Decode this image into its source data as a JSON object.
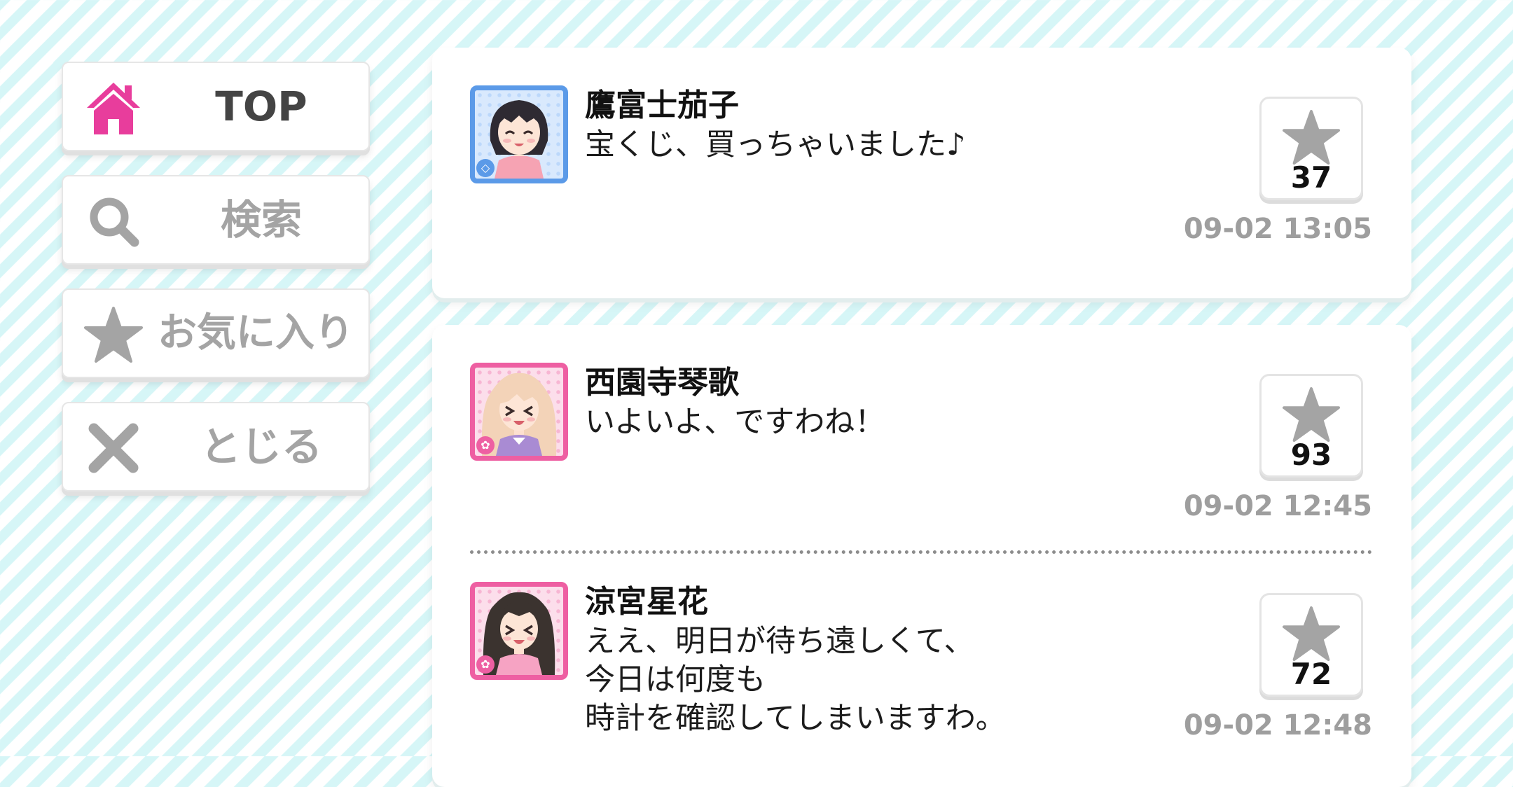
{
  "menu": {
    "items": [
      {
        "label": "TOP",
        "icon": "home-icon",
        "active": true
      },
      {
        "label": "検索",
        "icon": "search-icon",
        "active": false
      },
      {
        "label": "お気に入り",
        "icon": "star-icon",
        "active": false
      },
      {
        "label": "とじる",
        "icon": "close-icon",
        "active": false
      }
    ]
  },
  "colors": {
    "accent_pink": "#e83d9c",
    "icon_gray": "#a4a4a4",
    "stripe": "#d6f6f7",
    "avatar_blue": "#5b9ae8",
    "avatar_pink": "#ee5fa2"
  },
  "posts": [
    {
      "name": "鷹富士茄子",
      "message_lines": [
        "宝くじ、買っちゃいました♪"
      ],
      "likes": "37",
      "time": "09-02 13:05",
      "avatar_frame": "blue",
      "avatar_badge_icon": "diamond-icon"
    },
    {
      "name": "西園寺琴歌",
      "message_lines": [
        "いよいよ、ですわね！"
      ],
      "likes": "93",
      "time": "09-02 12:45",
      "avatar_frame": "pink",
      "avatar_badge_icon": "flower-icon"
    },
    {
      "name": "涼宮星花",
      "message_lines": [
        "ええ、明日が待ち遠しくて、",
        "今日は何度も",
        "時計を確認してしまいますわ。"
      ],
      "likes": "72",
      "time": "09-02 12:48",
      "avatar_frame": "pink",
      "avatar_badge_icon": "flower-icon"
    }
  ]
}
